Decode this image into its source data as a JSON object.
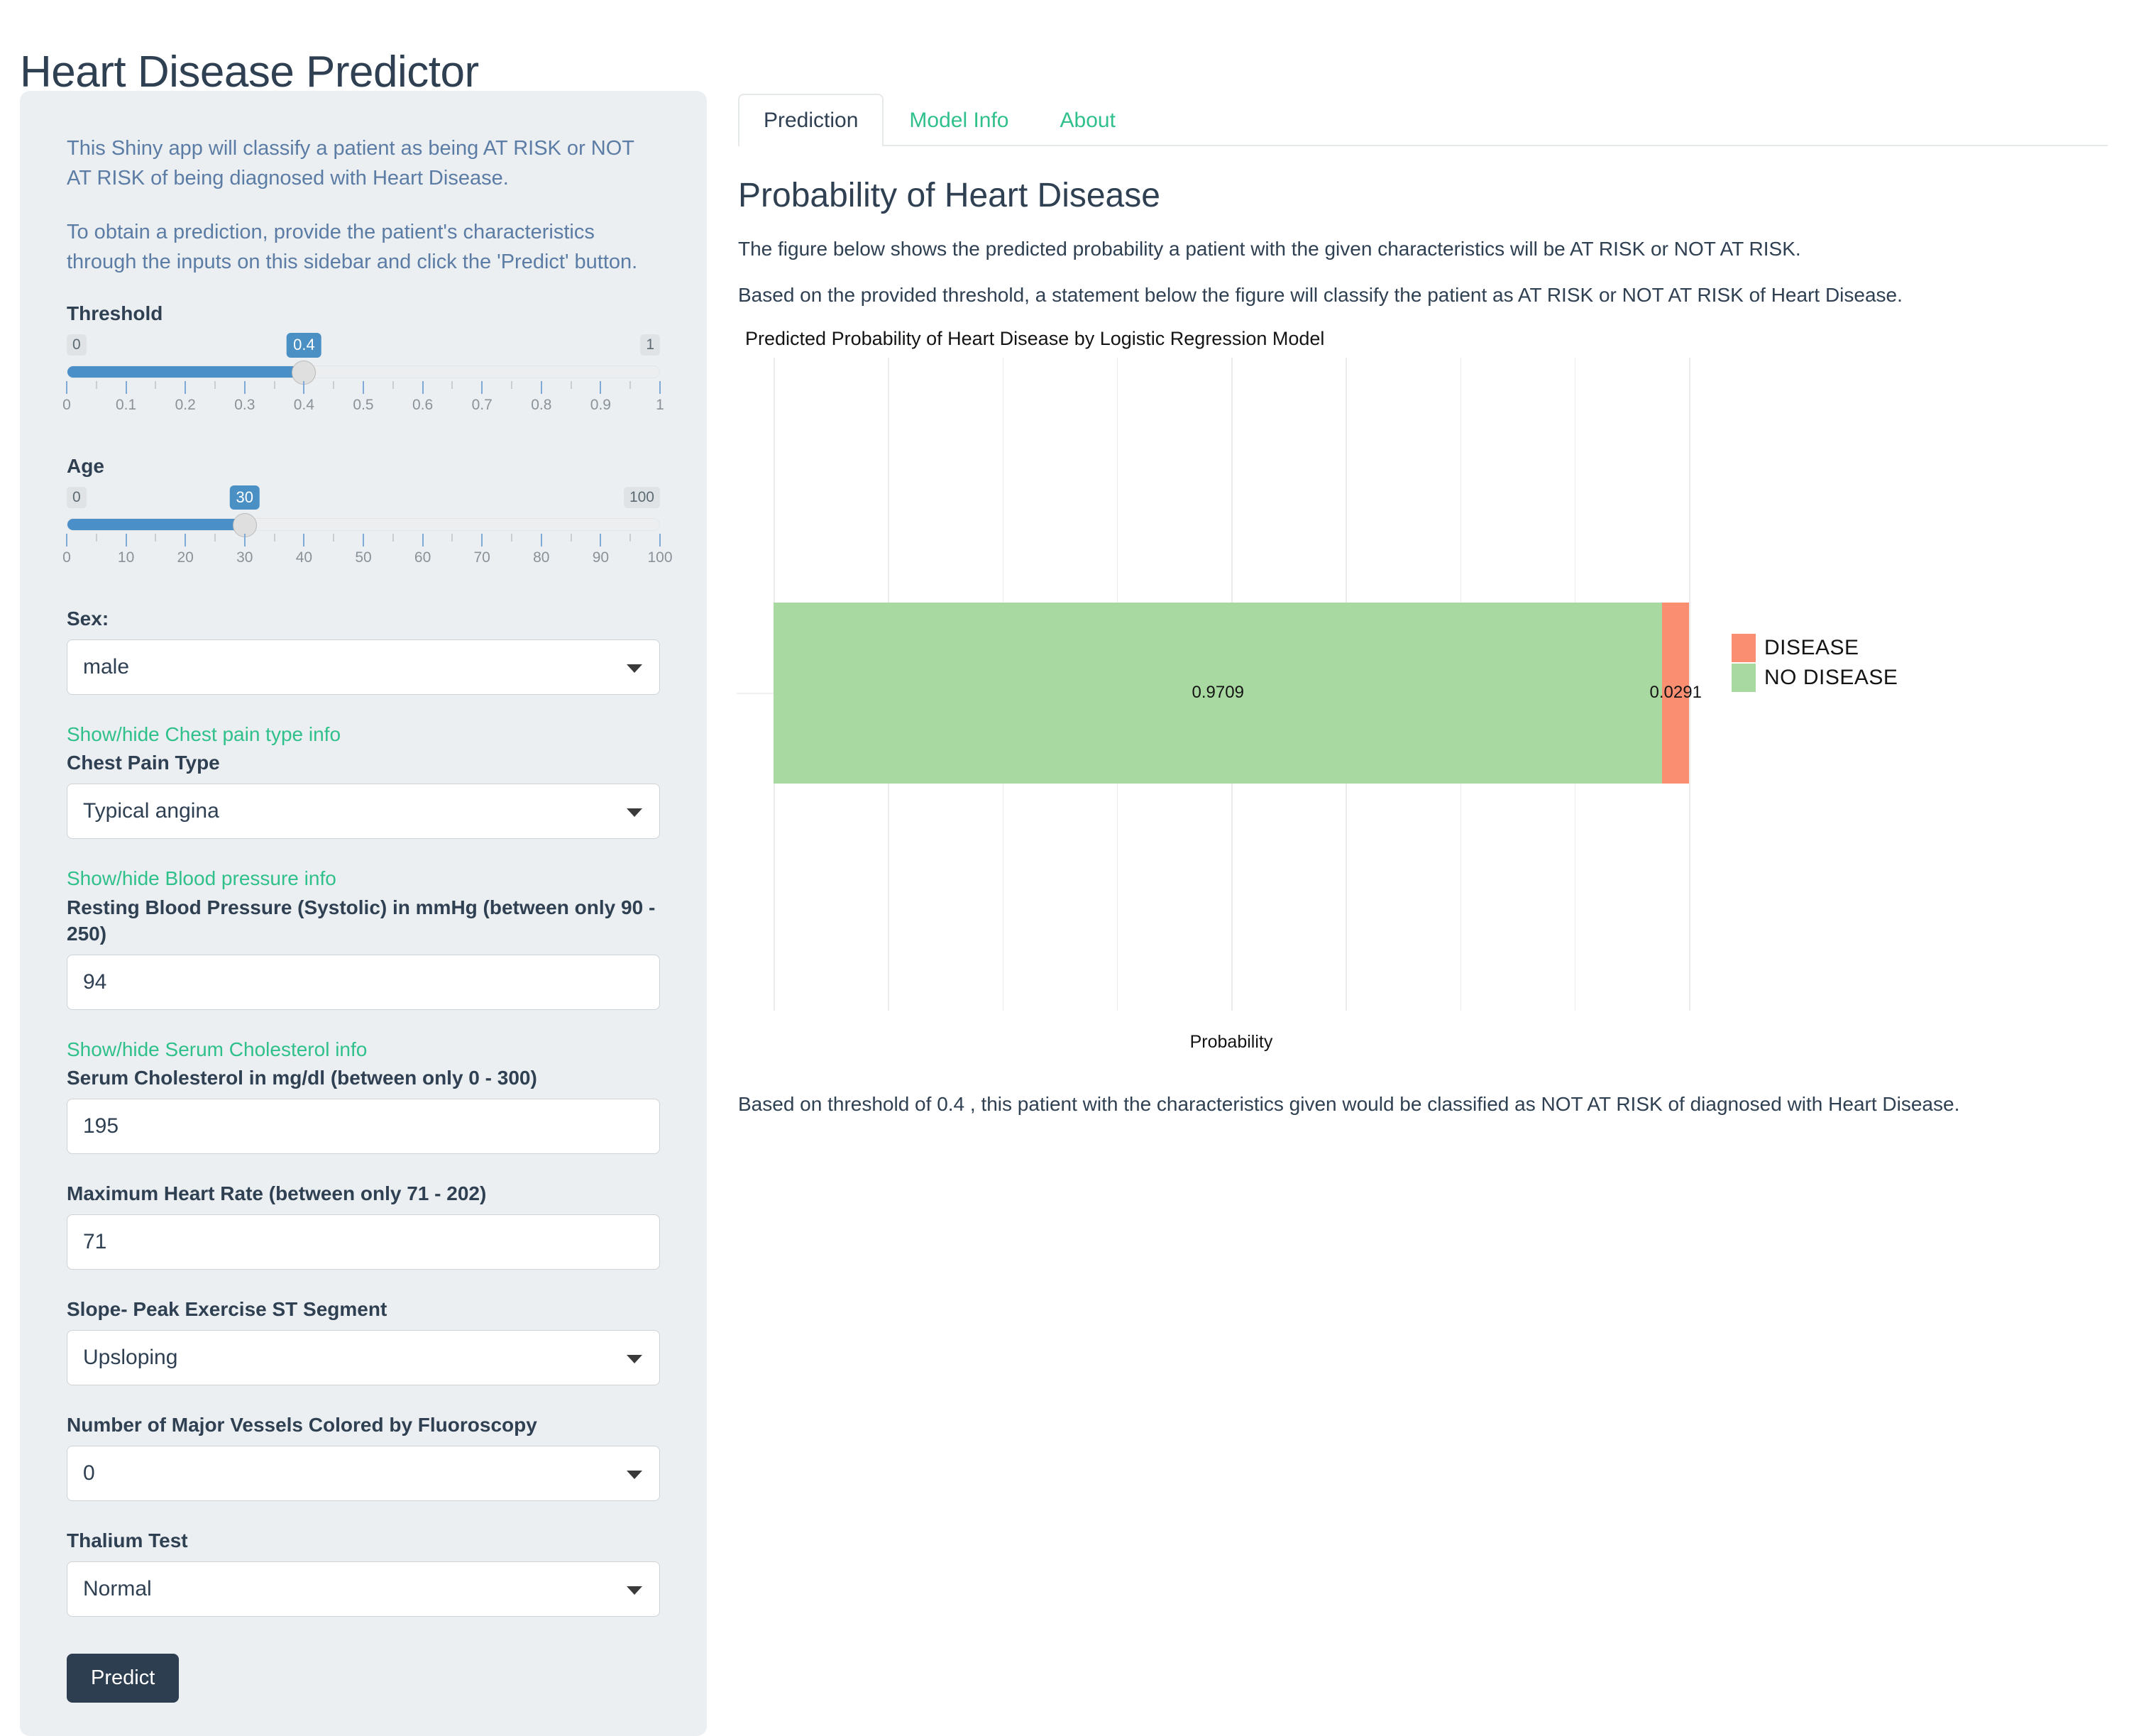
{
  "app": {
    "title": "Heart Disease Predictor",
    "accent_teal": "#2fc08b",
    "accent_blue": "#4a8fc7",
    "sidebar_bg": "#eceff1",
    "text_dark": "#2f4052"
  },
  "sidebar": {
    "intro_1": "This Shiny app will classify a patient as being AT RISK or NOT AT RISK of being diagnosed with Heart Disease.",
    "intro_2": "To obtain a prediction, provide the patient's characteristics through the inputs on this sidebar and click the 'Predict' button.",
    "threshold": {
      "label": "Threshold",
      "value": "0.4",
      "value_num": 0.4,
      "min_label": "0",
      "max_label": "1",
      "min": 0,
      "max": 1,
      "tick_labels": [
        "0",
        "0.1",
        "0.2",
        "0.3",
        "0.4",
        "0.5",
        "0.6",
        "0.7",
        "0.8",
        "0.9",
        "1"
      ]
    },
    "age": {
      "label": "Age",
      "value": "30",
      "value_num": 30,
      "min_label": "0",
      "max_label": "100",
      "min": 0,
      "max": 100,
      "tick_labels": [
        "0",
        "10",
        "20",
        "30",
        "40",
        "50",
        "60",
        "70",
        "80",
        "90",
        "100"
      ]
    },
    "sex": {
      "label": "Sex:",
      "value": "male"
    },
    "chest_pain_info_link": "Show/hide Chest pain type info",
    "chest_pain": {
      "label": "Chest Pain Type",
      "value": "Typical angina"
    },
    "blood_pressure_info_link": "Show/hide Blood pressure info",
    "blood_pressure": {
      "label": "Resting Blood Pressure (Systolic) in mmHg (between only 90 - 250)",
      "value": "94"
    },
    "cholesterol_info_link": "Show/hide Serum Cholesterol info",
    "cholesterol": {
      "label": "Serum Cholesterol in mg/dl (between only 0 - 300)",
      "value": "195"
    },
    "max_heart_rate": {
      "label": "Maximum Heart Rate (between only 71 - 202)",
      "value": "71"
    },
    "slope": {
      "label": "Slope- Peak Exercise ST Segment",
      "value": "Upsloping"
    },
    "vessels": {
      "label": "Number of Major Vessels Colored by Fluoroscopy",
      "value": "0"
    },
    "thalium": {
      "label": "Thalium Test",
      "value": "Normal"
    },
    "predict_button": "Predict"
  },
  "main": {
    "tabs": [
      {
        "label": "Prediction",
        "active": true
      },
      {
        "label": "Model Info",
        "active": false
      },
      {
        "label": "About",
        "active": false
      }
    ],
    "heading": "Probability of Heart Disease",
    "paragraph_1": "The figure below shows the predicted probability a patient with the given characteristics will be AT RISK or NOT AT RISK.",
    "paragraph_2": "Based on the provided threshold, a statement below the figure will classify the patient as AT RISK or NOT AT RISK of Heart Disease.",
    "conclusion": "Based on threshold of 0.4 , this patient with the characteristics given would be classified as NOT AT RISK of diagnosed with Heart Disease."
  },
  "chart_data": {
    "type": "bar",
    "orientation": "horizontal-stacked",
    "title": "Predicted Probability of Heart Disease by Logistic Regression Model",
    "xlabel": "Probability",
    "ylabel": "",
    "xlim": [
      0,
      1
    ],
    "grid": true,
    "legend_position": "right",
    "categories": [
      "Probability"
    ],
    "series": [
      {
        "name": "NO DISEASE",
        "values": [
          0.9709
        ],
        "label": "0.9709",
        "color": "#a8d9a0"
      },
      {
        "name": "DISEASE",
        "values": [
          0.0291
        ],
        "label": "0.0291",
        "color": "#f98e71"
      }
    ],
    "gridline_positions": [
      0.0,
      0.125,
      0.25,
      0.375,
      0.5,
      0.625,
      0.75,
      0.875,
      1.0
    ],
    "legend_entries": [
      {
        "label": "DISEASE",
        "color": "#f98e71"
      },
      {
        "label": "NO DISEASE",
        "color": "#a8d9a0"
      }
    ]
  }
}
